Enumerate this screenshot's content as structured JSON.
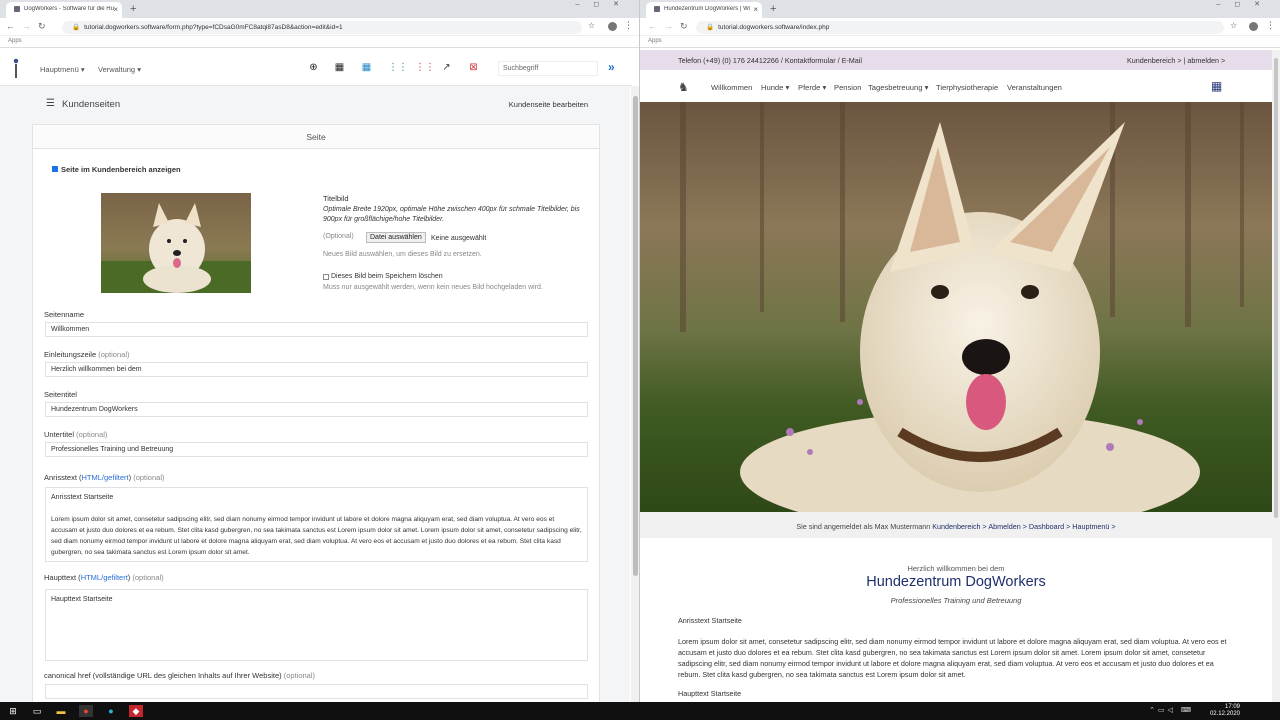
{
  "left_browser": {
    "tab_title": "DogWorkers - Software für die Hun",
    "url": "tutorial.dogworkers.software/form.php?type=fCDsaG0mFC8atqi87asD8&action=edit&id=1",
    "bookmarks": "Apps",
    "app": {
      "menu_main": "Hauptmenü ▾",
      "menu_admin": "Verwaltung ▾",
      "search_placeholder": "Suchbegriff",
      "page_title": "Kundenseiten",
      "edit_link": "Kundenseite bearbeiten",
      "card_title": "Seite",
      "show_in_customer_area": "Seite im Kundenbereich anzeigen",
      "title_image": {
        "label": "Titelbild",
        "hint": "Optimale Breite 1920px, optimale Höhe zwischen 400px für schmale Titelbilder, bis 900px für großflächige/hohe Titelbilder.",
        "optional": "(Optional)",
        "choose_button": "Datei auswählen",
        "no_file": "Keine ausgewählt",
        "help": "Neues Bild auswählen, um dieses Bild zu ersetzen.",
        "delete_label": "Dieses Bild beim Speichern löschen",
        "delete_help": "Muss nur ausgewählt werden, wenn kein neues Bild hochgeladen wird."
      },
      "fields": {
        "pagename_label": "Seitenname",
        "pagename_value": "Willkommen",
        "intro_label": "Einleitungszeile",
        "intro_optional": "(optional)",
        "intro_value": "Herzlich willkommen bei dem",
        "title_label": "Seitentitel",
        "title_value": "Hundezentrum DogWorkers",
        "subtitle_label": "Untertitel",
        "subtitle_optional": "(optional)",
        "subtitle_value": "Professionelles Training und Betreuung",
        "teaser_label": "Anrisstext (",
        "teaser_link": "HTML/gefiltert",
        "teaser_after": ")",
        "teaser_optional": "(optional)",
        "teaser_line1": "Anrisstext Startseite",
        "teaser_line2": "Lorem ipsum dolor sit amet, consetetur sadipscing elitr, sed diam nonumy eirmod tempor invidunt ut labore et dolore magna aliquyam erat, sed diam voluptua. At vero eos et accusam et justo duo dolores et ea rebum. Stet clita kasd gubergren, no sea takimata sanctus est Lorem ipsum dolor sit amet. Lorem ipsum dolor sit amet, consetetur sadipscing elitr, sed diam nonumy eirmod tempor invidunt ut labore et dolore magna aliquyam erat, sed diam voluptua. At vero eos et accusam et justo duo dolores et ea rebum. Stet clita kasd gubergren, no sea takimata sanctus est Lorem ipsum dolor sit amet.",
        "main_label": "Haupttext (",
        "main_link": "HTML/gefiltert",
        "main_after": ")",
        "main_optional": "(optional)",
        "main_value": "Haupttext Startseite",
        "canonical_label": "canonical href (vollständige URL des gleichen Inhalts auf Ihrer Website)",
        "canonical_optional": "(optional)"
      }
    }
  },
  "right_browser": {
    "tab_title": "Hundezentrum DogWorkers | Wi",
    "url": "tutorial.dogworkers.software/index.php",
    "bookmarks": "Apps",
    "site": {
      "contact": "Telefon (+49) (0) 176 24412266 / Kontaktformular / E-Mail",
      "account": "Kundenbereich > | abmelden >",
      "nav": [
        "Willkommen",
        "Hunde ▾",
        "Pferde ▾",
        "Pension",
        "Tagesbetreuung ▾",
        "Tierphysiotherapie",
        "Veranstaltungen"
      ],
      "crumb_prefix": "Sie sind angemeldet als Max Mustermann",
      "crumb_links": "Kundenbereich > Abmelden > Dashboard > Hauptmenü >",
      "greeting": "Herzlich willkommen bei dem",
      "title": "Hundezentrum DogWorkers",
      "subtitle": "Professionelles Training und Betreuung",
      "teaser_heading": "Anrisstext Startseite",
      "teaser_body": "Lorem ipsum dolor sit amet, consetetur sadipscing elitr, sed diam nonumy eirmod tempor invidunt ut labore et dolore magna aliquyam erat, sed diam voluptua. At vero eos et accusam et justo duo dolores et ea rebum. Stet clita kasd gubergren, no sea takimata sanctus est Lorem ipsum dolor sit amet. Lorem ipsum dolor sit amet, consetetur sadipscing elitr, sed diam nonumy eirmod tempor invidunt ut labore et dolore magna aliquyam erat, sed diam voluptua. At vero eos et accusam et justo duo dolores et ea rebum. Stet clita kasd gubergren, no sea takimata sanctus est Lorem ipsum dolor sit amet.",
      "main_heading": "Haupttext Startseite"
    }
  },
  "taskbar": {
    "time": "17:09",
    "date": "02.12.2020"
  },
  "colors": {
    "accent_blue": "#2a6fd6",
    "site_navy": "#1f2f6b",
    "site_strip": "#e6dcea"
  }
}
